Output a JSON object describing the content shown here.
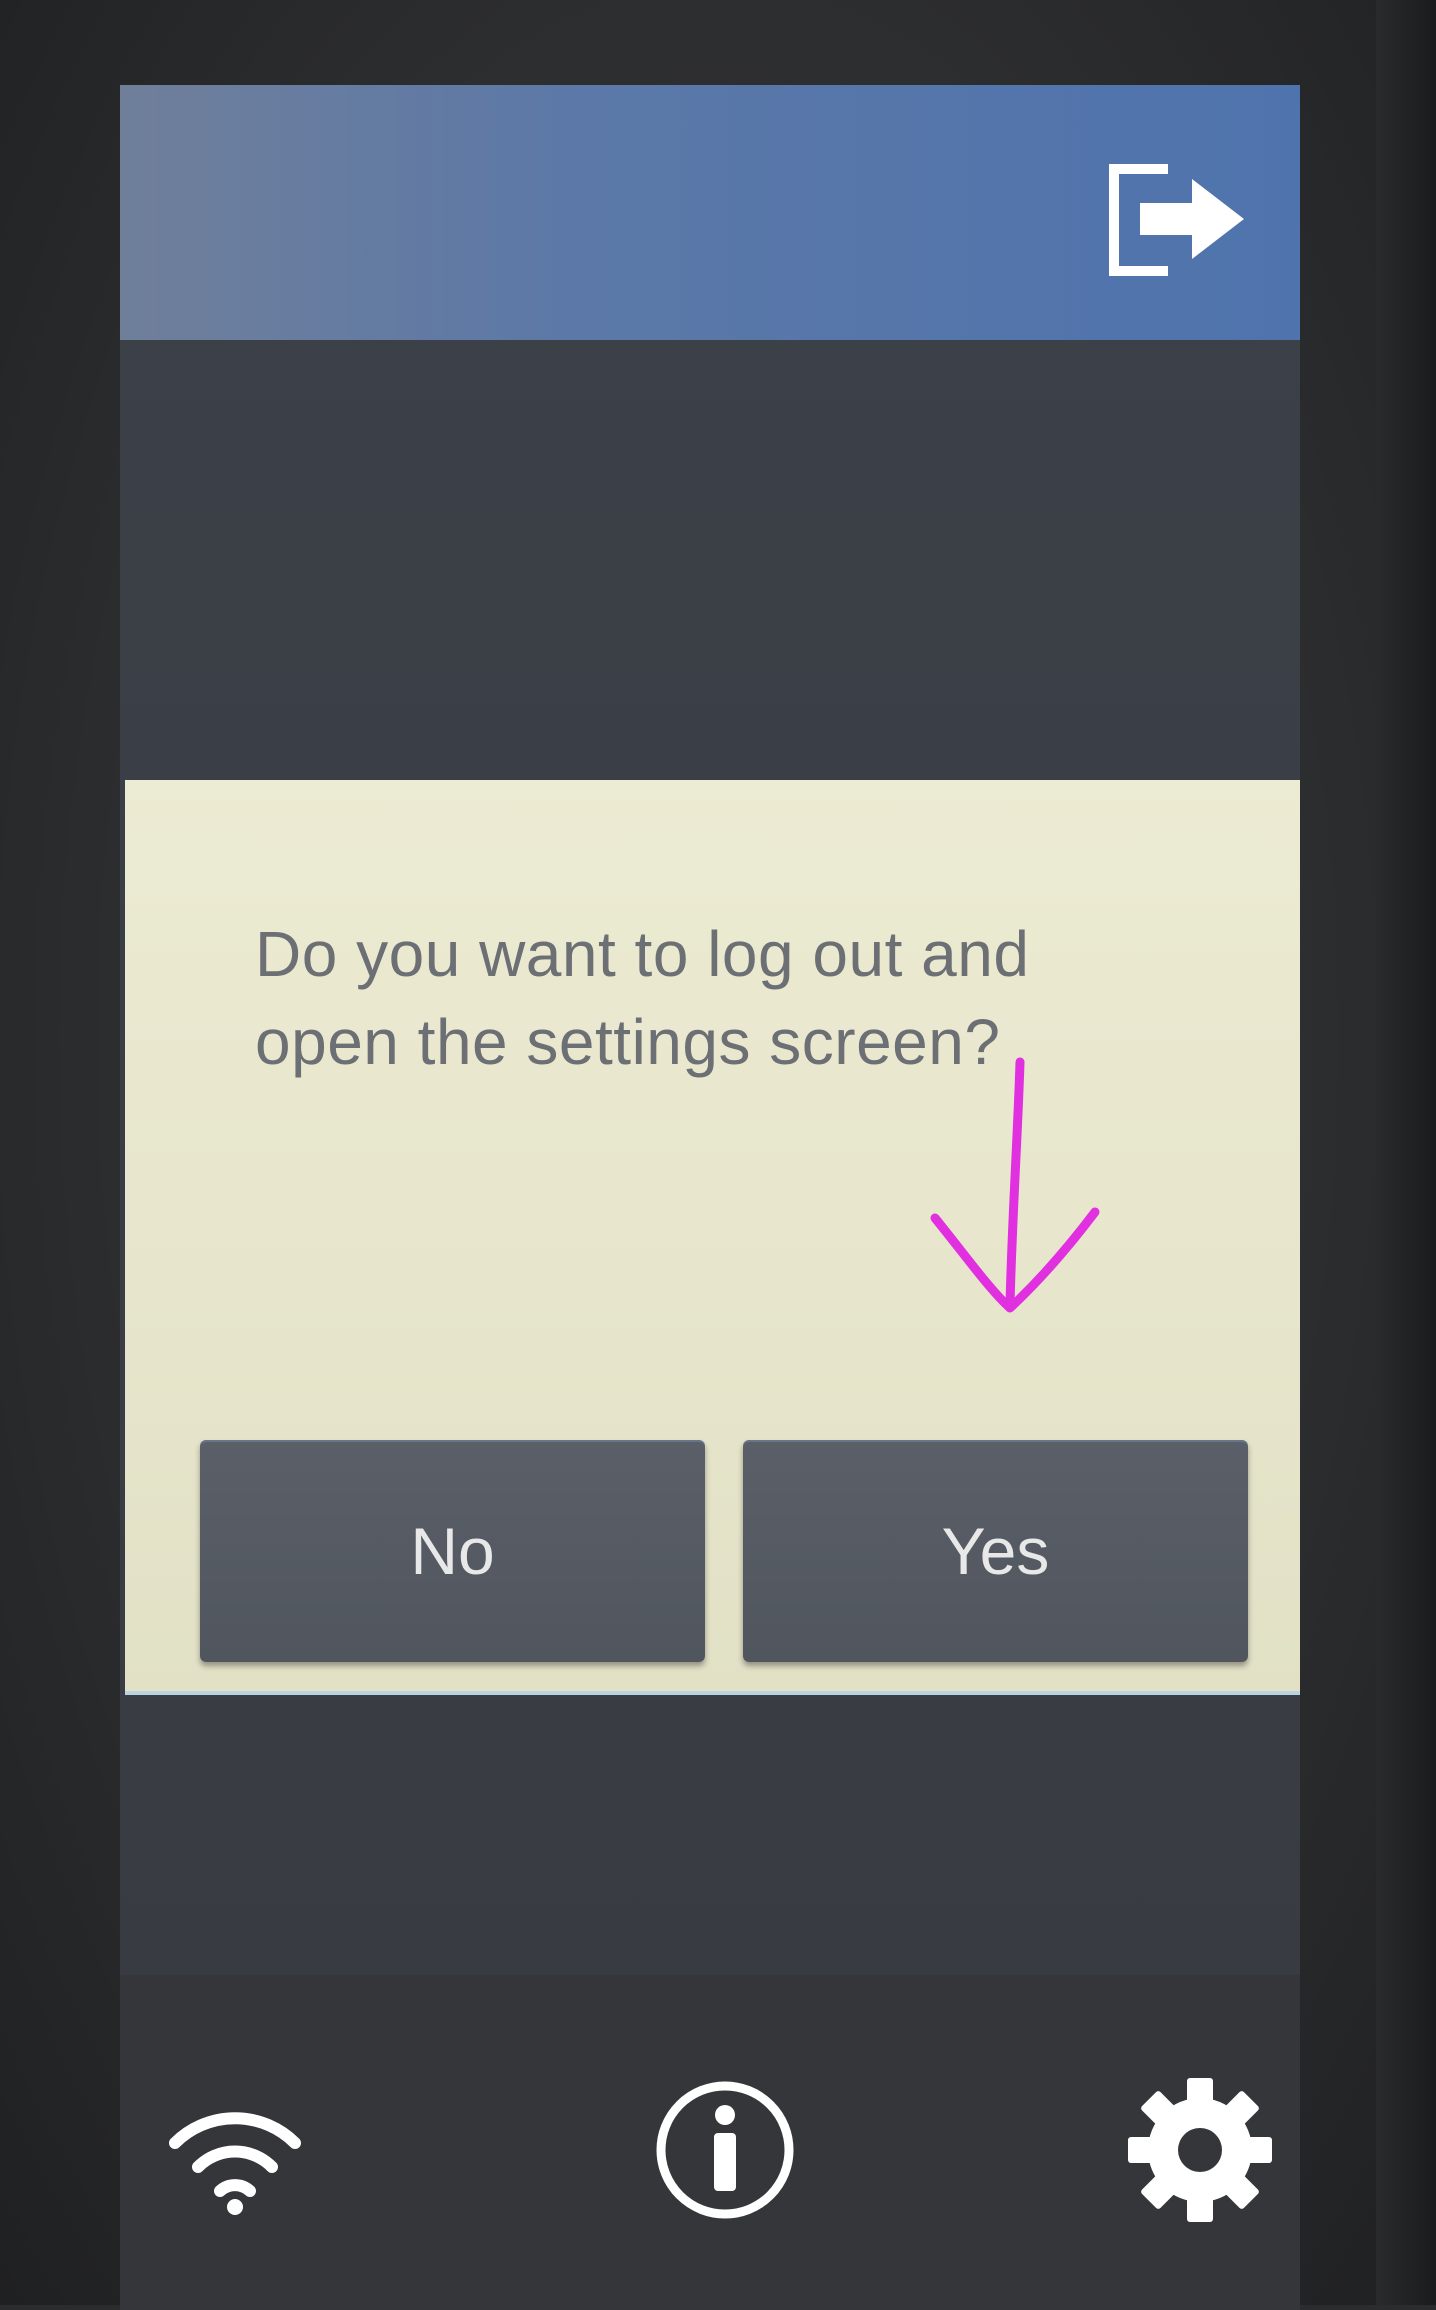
{
  "header": {
    "logout_icon": "logout-icon"
  },
  "dialog": {
    "message_line1": "Do you want to log out and",
    "message_line2": "open the settings screen?",
    "no_label": "No",
    "yes_label": "Yes"
  },
  "footer": {
    "icons": [
      "wifi-icon",
      "info-icon",
      "gear-icon"
    ]
  },
  "colors": {
    "header_blue": "#4f73ad",
    "dialog_bg": "#e7e6cc",
    "button_bg": "#545962",
    "annotation_arrow": "#e030e0"
  }
}
